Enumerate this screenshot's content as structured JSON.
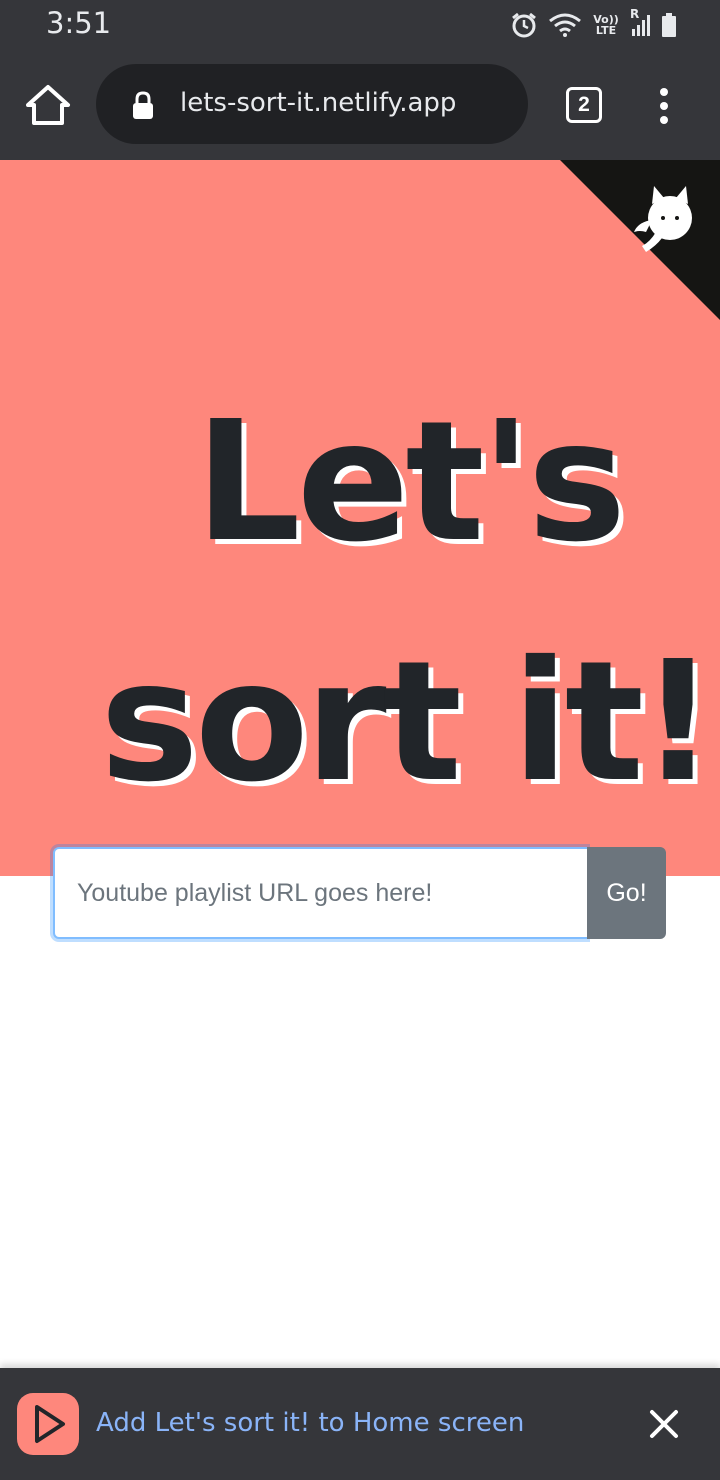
{
  "status_bar": {
    "time": "3:51",
    "network_label": "Vo)) LTE",
    "roaming_label": "R"
  },
  "browser": {
    "url": "lets-sort-it.netlify.app",
    "tab_count": "2"
  },
  "page": {
    "title_line1": "Let's",
    "title_line2": "sort it!",
    "input_placeholder": "Youtube playlist URL goes here!",
    "input_value": "",
    "go_button": "Go!",
    "hero_color": "#fe877c",
    "text_color": "#212529"
  },
  "install_banner": {
    "message": "Add Let's sort it! to Home screen"
  },
  "icons": [
    "home-icon",
    "lock-icon",
    "tabs-icon",
    "menu-icon",
    "github-icon",
    "close-icon",
    "alarm-icon",
    "wifi-icon",
    "signal-icon",
    "battery-icon",
    "play-icon"
  ]
}
